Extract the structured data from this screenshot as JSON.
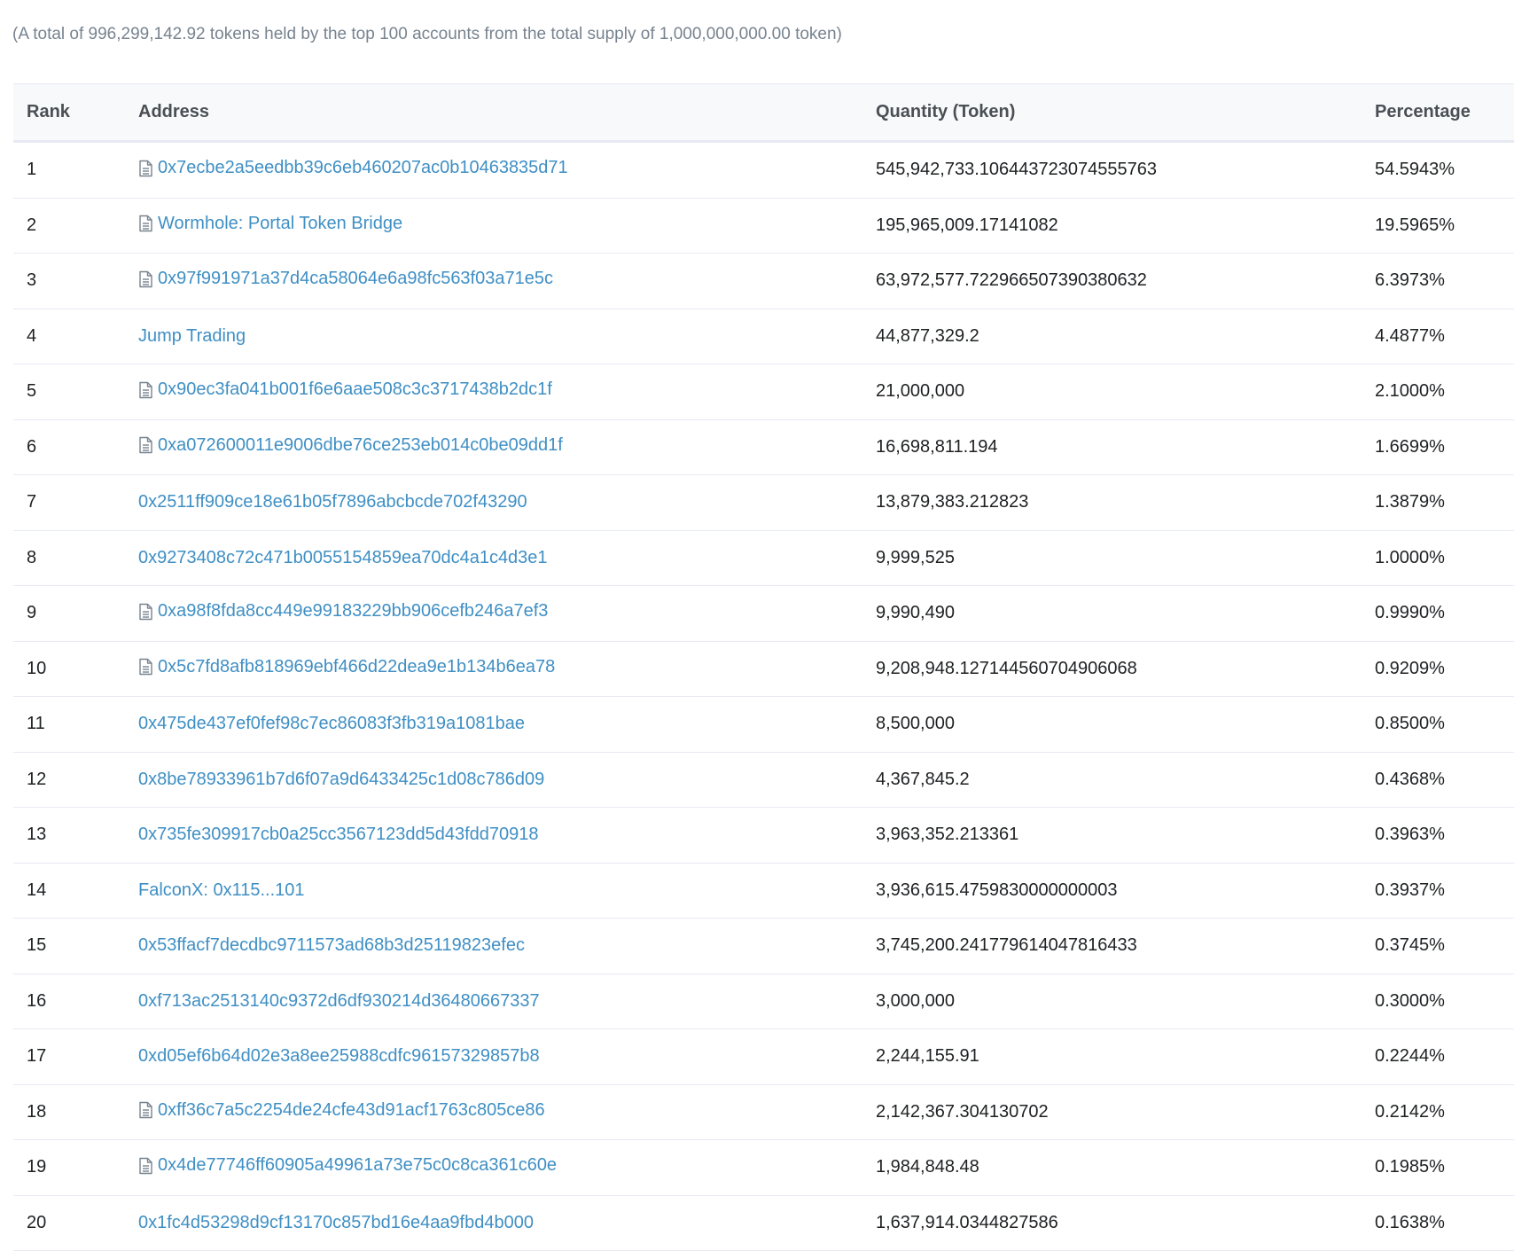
{
  "summary": "(A total of 996,299,142.92 tokens held by the top 100 accounts from the total supply of 1,000,000,000.00 token)",
  "table": {
    "headers": {
      "rank": "Rank",
      "address": "Address",
      "quantity": "Quantity (Token)",
      "percentage": "Percentage"
    },
    "rows": [
      {
        "rank": "1",
        "address": "0x7ecbe2a5eedbb39c6eb460207ac0b10463835d71",
        "contract": true,
        "quantity": "545,942,733.106443723074555763",
        "percentage": "54.5943%"
      },
      {
        "rank": "2",
        "address": "Wormhole: Portal Token Bridge",
        "contract": true,
        "quantity": "195,965,009.17141082",
        "percentage": "19.5965%"
      },
      {
        "rank": "3",
        "address": "0x97f991971a37d4ca58064e6a98fc563f03a71e5c",
        "contract": true,
        "quantity": "63,972,577.722966507390380632",
        "percentage": "6.3973%"
      },
      {
        "rank": "4",
        "address": "Jump Trading",
        "contract": false,
        "quantity": "44,877,329.2",
        "percentage": "4.4877%"
      },
      {
        "rank": "5",
        "address": "0x90ec3fa041b001f6e6aae508c3c3717438b2dc1f",
        "contract": true,
        "quantity": "21,000,000",
        "percentage": "2.1000%"
      },
      {
        "rank": "6",
        "address": "0xa072600011e9006dbe76ce253eb014c0be09dd1f",
        "contract": true,
        "quantity": "16,698,811.194",
        "percentage": "1.6699%"
      },
      {
        "rank": "7",
        "address": "0x2511ff909ce18e61b05f7896abcbcde702f43290",
        "contract": false,
        "quantity": "13,879,383.212823",
        "percentage": "1.3879%"
      },
      {
        "rank": "8",
        "address": "0x9273408c72c471b0055154859ea70dc4a1c4d3e1",
        "contract": false,
        "quantity": "9,999,525",
        "percentage": "1.0000%"
      },
      {
        "rank": "9",
        "address": "0xa98f8fda8cc449e99183229bb906cefb246a7ef3",
        "contract": true,
        "quantity": "9,990,490",
        "percentage": "0.9990%"
      },
      {
        "rank": "10",
        "address": "0x5c7fd8afb818969ebf466d22dea9e1b134b6ea78",
        "contract": true,
        "quantity": "9,208,948.127144560704906068",
        "percentage": "0.9209%"
      },
      {
        "rank": "11",
        "address": "0x475de437ef0fef98c7ec86083f3fb319a1081bae",
        "contract": false,
        "quantity": "8,500,000",
        "percentage": "0.8500%"
      },
      {
        "rank": "12",
        "address": "0x8be78933961b7d6f07a9d6433425c1d08c786d09",
        "contract": false,
        "quantity": "4,367,845.2",
        "percentage": "0.4368%"
      },
      {
        "rank": "13",
        "address": "0x735fe309917cb0a25cc3567123dd5d43fdd70918",
        "contract": false,
        "quantity": "3,963,352.213361",
        "percentage": "0.3963%"
      },
      {
        "rank": "14",
        "address": "FalconX: 0x115...101",
        "contract": false,
        "quantity": "3,936,615.4759830000000003",
        "percentage": "0.3937%"
      },
      {
        "rank": "15",
        "address": "0x53ffacf7decdbc9711573ad68b3d25119823efec",
        "contract": false,
        "quantity": "3,745,200.241779614047816433",
        "percentage": "0.3745%"
      },
      {
        "rank": "16",
        "address": "0xf713ac2513140c9372d6df930214d36480667337",
        "contract": false,
        "quantity": "3,000,000",
        "percentage": "0.3000%"
      },
      {
        "rank": "17",
        "address": "0xd05ef6b64d02e3a8ee25988cdfc96157329857b8",
        "contract": false,
        "quantity": "2,244,155.91",
        "percentage": "0.2244%"
      },
      {
        "rank": "18",
        "address": "0xff36c7a5c2254de24cfe43d91acf1763c805ce86",
        "contract": true,
        "quantity": "2,142,367.304130702",
        "percentage": "0.2142%"
      },
      {
        "rank": "19",
        "address": "0x4de77746ff60905a49961a73e75c0c8ca361c60e",
        "contract": true,
        "quantity": "1,984,848.48",
        "percentage": "0.1985%"
      },
      {
        "rank": "20",
        "address": "0x1fc4d53298d9cf13170c857bd16e4aa9fbd4b000",
        "contract": false,
        "quantity": "1,637,914.0344827586",
        "percentage": "0.1638%"
      }
    ]
  },
  "icons": {
    "contract": "file-document-icon"
  },
  "colors": {
    "link": "#3f8fc4",
    "text": "#1e2022",
    "muted": "#77838f",
    "header_bg": "#f8f9fa",
    "border": "#e7eaf3"
  }
}
